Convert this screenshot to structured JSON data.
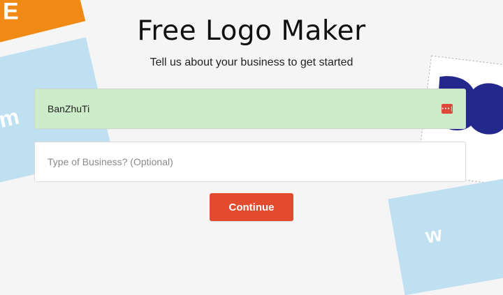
{
  "page": {
    "title": "Free Logo Maker",
    "subtitle": "Tell us about your business to get started"
  },
  "form": {
    "business_name_value": "BanZhuTi",
    "business_type_placeholder": "Type of Business? (Optional)",
    "continue_label": "Continue",
    "autofill_icon": "password-manager-icon"
  },
  "decorations": {
    "left_card_text": "om",
    "orange_card_letter": "E",
    "right_bottom_card_text": "w",
    "colors": {
      "orange": "#f08a14",
      "light_blue": "#bfe0f1",
      "navy": "#23288c",
      "button": "#e24b2e",
      "autofill_bg": "#cdecca"
    }
  }
}
